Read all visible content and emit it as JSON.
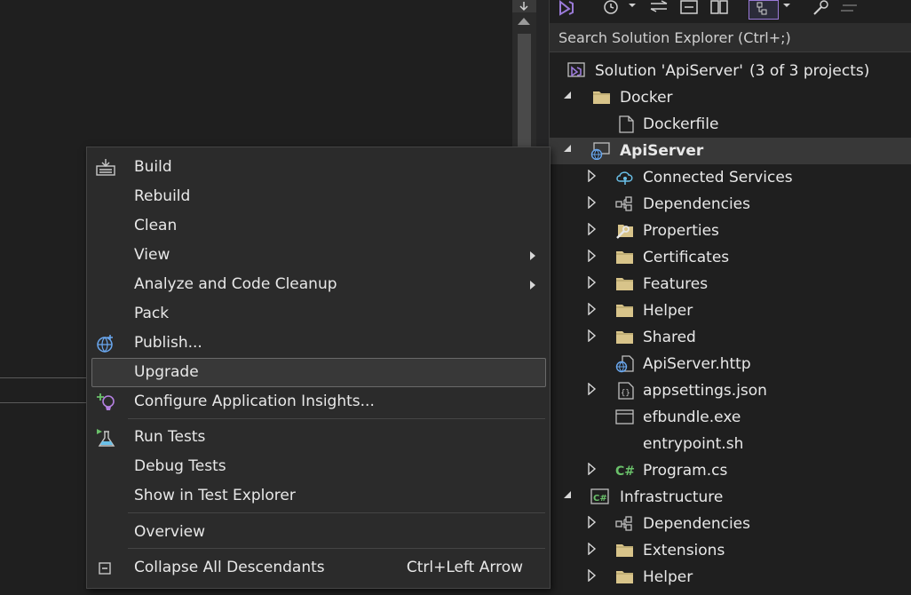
{
  "search": {
    "placeholder": "Search Solution Explorer (Ctrl+;)"
  },
  "tree": [
    {
      "label": "Solution 'ApiServer'",
      "suffix": "(3 of 3 projects)",
      "icon": "solution-icon"
    },
    {
      "label": "Docker",
      "icon": "folder-icon"
    },
    {
      "label": "Dockerfile",
      "icon": "file-icon"
    },
    {
      "label": "ApiServer",
      "icon": "web-project-icon"
    },
    {
      "label": "Connected Services",
      "icon": "connected-services-icon"
    },
    {
      "label": "Dependencies",
      "icon": "dependencies-icon"
    },
    {
      "label": "Properties",
      "icon": "properties-icon"
    },
    {
      "label": "Certificates",
      "icon": "folder-icon"
    },
    {
      "label": "Features",
      "icon": "folder-icon"
    },
    {
      "label": "Helper",
      "icon": "folder-icon"
    },
    {
      "label": "Shared",
      "icon": "folder-icon"
    },
    {
      "label": "ApiServer.http",
      "icon": "http-file-icon"
    },
    {
      "label": "appsettings.json",
      "icon": "json-file-icon"
    },
    {
      "label": "efbundle.exe",
      "icon": "exe-file-icon"
    },
    {
      "label": "entrypoint.sh",
      "icon": "script-file-icon"
    },
    {
      "label": "Program.cs",
      "icon": "csharp-file-icon"
    },
    {
      "label": "Infrastructure",
      "icon": "csharp-project-icon"
    },
    {
      "label": "Dependencies",
      "icon": "dependencies-icon"
    },
    {
      "label": "Extensions",
      "icon": "folder-icon"
    },
    {
      "label": "Helper",
      "icon": "folder-icon"
    }
  ],
  "menu": {
    "items": [
      {
        "label": "Build",
        "icon": "build-icon"
      },
      {
        "label": "Rebuild"
      },
      {
        "label": "Clean"
      },
      {
        "label": "View",
        "submenu": true
      },
      {
        "label": "Analyze and Code Cleanup",
        "submenu": true
      },
      {
        "label": "Pack"
      },
      {
        "label": "Publish...",
        "icon": "publish-globe-icon"
      },
      {
        "label": "Upgrade",
        "highlighted": true
      },
      {
        "label": "Configure Application Insights...",
        "icon": "app-insights-icon"
      },
      {
        "label": "Run Tests",
        "icon": "run-tests-icon"
      },
      {
        "label": "Debug Tests"
      },
      {
        "label": "Show in Test Explorer"
      },
      {
        "label": "Overview"
      },
      {
        "label": "Collapse All Descendants",
        "shortcut": "Ctrl+Left Arrow",
        "icon": "collapse-icon"
      }
    ]
  },
  "colors": {
    "accent": "#9a7ad8",
    "folder": "#d8c48a",
    "highlight_border": "#6a6a6a"
  }
}
